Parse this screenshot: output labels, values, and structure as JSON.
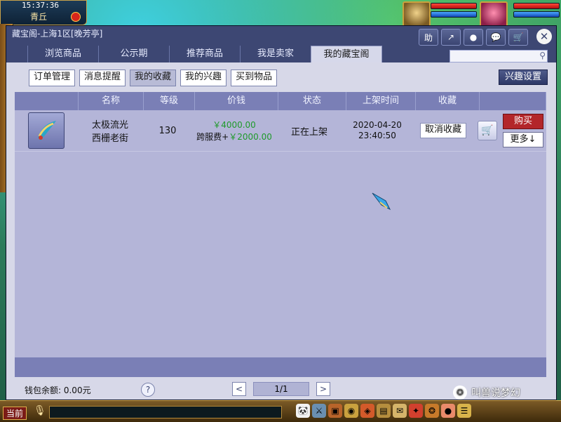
{
  "hud": {
    "clock": "15:37:36",
    "location": "青丘"
  },
  "window": {
    "title": "藏宝阁-上海1区[晚芳亭]",
    "buttons": {
      "help": "助",
      "share": "↗",
      "record": "●",
      "chat": "💬",
      "cart": "🛒",
      "close": "✕"
    }
  },
  "tabs": [
    {
      "label": "浏览商品"
    },
    {
      "label": "公示期"
    },
    {
      "label": "推荐商品"
    },
    {
      "label": "我是卖家"
    },
    {
      "label": "我的藏宝阁"
    }
  ],
  "search": {
    "placeholder": "",
    "value": ""
  },
  "subtabs": [
    {
      "label": "订单管理"
    },
    {
      "label": "消息提醒"
    },
    {
      "label": "我的收藏"
    },
    {
      "label": "我的兴趣"
    },
    {
      "label": "买到物品"
    }
  ],
  "interest_settings": "兴趣设置",
  "table": {
    "headers": [
      "名称",
      "等级",
      "价钱",
      "状态",
      "上架时间",
      "收藏"
    ],
    "rows": [
      {
        "name_line1": "太极流光",
        "name_line2": "西栅老街",
        "level": "130",
        "price": "￥4000.00",
        "fee_label": "跨服费+",
        "fee": "￥2000.00",
        "status": "正在上架",
        "date": "2020-04-20",
        "time": "23:40:50",
        "unfavorite": "取消收藏",
        "buy": "购买",
        "more": "更多↓"
      }
    ]
  },
  "footer": {
    "wallet": "钱包余额: 0.00元",
    "help": "?",
    "page": "1/1",
    "prev": "<",
    "next": ">"
  },
  "bottom": {
    "channel": "当前"
  },
  "watermark": "叫兽说梦幻"
}
